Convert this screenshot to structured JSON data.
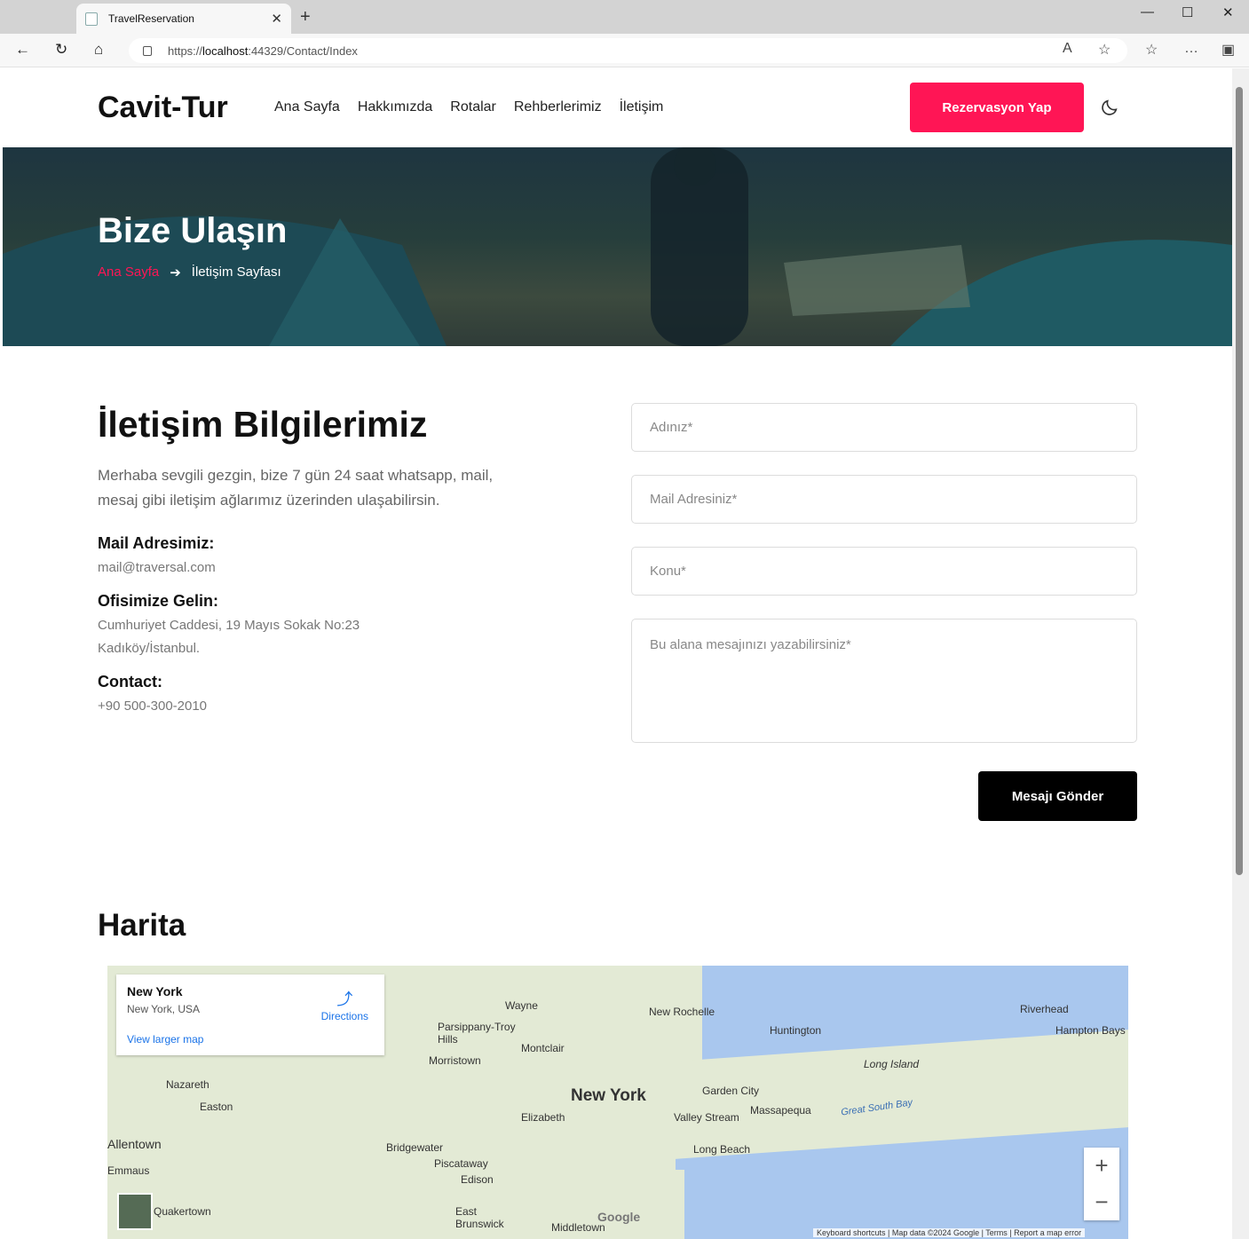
{
  "browser": {
    "tab_title": "TravelReservation",
    "url_prefix": "https://",
    "url_host": "localhost",
    "url_rest": ":44329/Contact/Index"
  },
  "header": {
    "logo": "Cavit-Tur",
    "nav": [
      "Ana Sayfa",
      "Hakkımızda",
      "Rotalar",
      "Rehberlerimiz",
      "İletişim"
    ],
    "cta": "Rezervasyon Yap"
  },
  "hero": {
    "title": "Bize Ulaşın",
    "crumb_home": "Ana Sayfa",
    "crumb_current": "İletişim Sayfası"
  },
  "contact": {
    "title": "İletişim Bilgilerimiz",
    "intro": "Merhaba sevgili gezgin, bize 7 gün 24 saat whatsapp, mail, mesaj gibi iletişim ağlarımız üzerinden ulaşabilirsin.",
    "mail_label": "Mail Adresimiz:",
    "mail": "mail@traversal.com",
    "office_label": "Ofisimize Gelin:",
    "office_line1": "Cumhuriyet Caddesi, 19 Mayıs Sokak No:23",
    "office_line2": "Kadıköy/İstanbul.",
    "phone_label": "Contact:",
    "phone": "+90 500-300-2010"
  },
  "form": {
    "name": "Adınız*",
    "email": "Mail Adresiniz*",
    "subject": "Konu*",
    "message": "Bu alana mesajınızı yazabilirsiniz*",
    "submit": "Mesajı Gönder"
  },
  "map": {
    "title": "Harita",
    "place": "New York",
    "place_sub": "New York, USA",
    "directions": "Directions",
    "larger": "View larger map",
    "labels": [
      "New York",
      "Wayne",
      "Parsippany-Troy Hills",
      "Montclair",
      "Morristown",
      "New Rochelle",
      "Huntington",
      "Riverhead",
      "Hampton Bays",
      "Long Island",
      "Garden City",
      "Massapequa",
      "Valley Stream",
      "Long Beach",
      "Elizabeth",
      "Bridgewater",
      "Piscataway",
      "Edison",
      "East Brunswick",
      "Middletown",
      "Nazareth",
      "Easton",
      "Allentown",
      "Emmaus",
      "Quakertown",
      "Great South Bay"
    ],
    "attribution": "Keyboard shortcuts | Map data ©2024 Google | Terms | Report a map error",
    "logo": "Google"
  }
}
